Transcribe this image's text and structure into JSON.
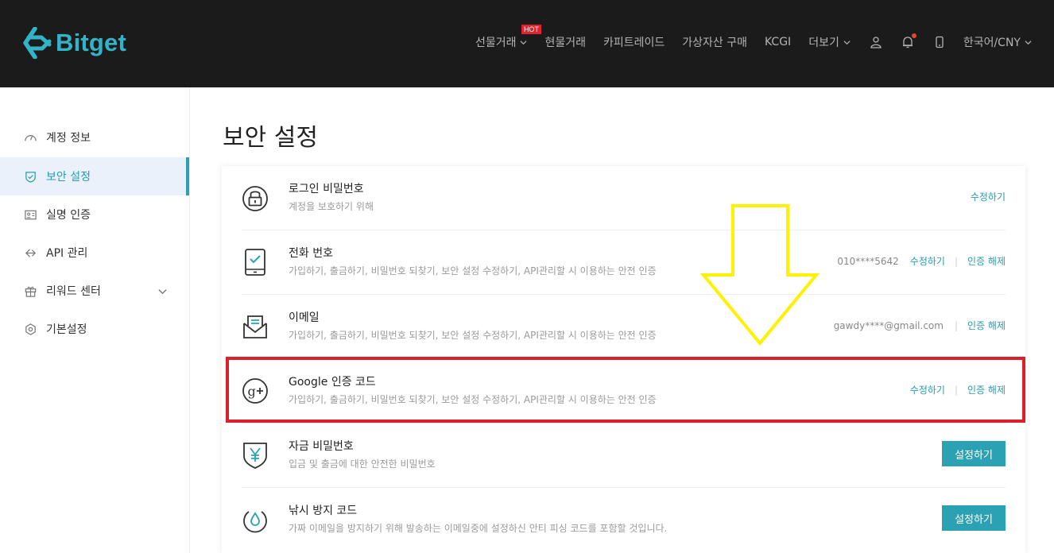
{
  "header": {
    "brand": "Bitget",
    "brand_color": "#32b3c8",
    "nav": {
      "futures": "선물거래",
      "hot_badge": "HOT",
      "spot": "현물거래",
      "copy_trade": "카피트레이드",
      "buy_crypto": "가상자산 구매",
      "kcgi": "KCGI",
      "more": "더보기",
      "language": "한국어/CNY"
    },
    "icons": [
      "user-icon",
      "bell-icon",
      "phone-icon"
    ]
  },
  "sidebar": {
    "items": [
      {
        "label": "계정 정보",
        "icon": "speedometer-icon"
      },
      {
        "label": "보안 설정",
        "icon": "shield-check-icon",
        "active": true
      },
      {
        "label": "실명 인증",
        "icon": "id-card-icon"
      },
      {
        "label": "API 관리",
        "icon": "api-icon"
      },
      {
        "label": "리워드 센터",
        "icon": "gift-icon"
      },
      {
        "label": "기본설정",
        "icon": "settings-icon"
      }
    ]
  },
  "main": {
    "title": "보안 설정",
    "rows": [
      {
        "title": "로그인 비밀번호",
        "desc": "계정을 보호하기 위해",
        "icon": "lock-icon",
        "edit": "수정하기"
      },
      {
        "title": "전화 번호",
        "desc": "가입하기, 출금하기, 비밀번호 되찾기, 보안 설정 수정하기, API관리할 시 이용하는 안전 인증",
        "icon": "phone-check-icon",
        "masked": "010****5642",
        "edit": "수정하기",
        "unbind": "인증 해제"
      },
      {
        "title": "이메일",
        "desc": "가입하기, 출금하기, 비밀번호 되찾기, 보안 설정 수정하기, API관리할 시 이용하는 안전 인증",
        "icon": "mail-icon",
        "masked": "gawdy****@gmail.com",
        "unbind": "인증 해제"
      },
      {
        "title": "Google 인증 코드",
        "desc": "가입하기, 출금하기, 비밀번호 되찾기, 보안 설정 수정하기, API관리할 시 이용하는 안전 인증",
        "icon": "google-plus-icon",
        "edit": "수정하기",
        "unbind": "인증 해제"
      },
      {
        "title": "자금 비밀번호",
        "desc": "입금 및 출금에 대한 안전한 비밀번호",
        "icon": "yen-shield-icon",
        "button": "설정하기"
      },
      {
        "title": "낚시 방지 코드",
        "desc": "가짜 이메일을 방지하기 위해 발송하는 이메일중에 설정하신 안티 피싱 코드를 포함할 것입니다.",
        "icon": "drop-icon",
        "button": "설정하기"
      }
    ]
  },
  "colors": {
    "accent": "#2aa2b4",
    "highlight_box": "#dd1f2b",
    "arrow": "#fff200",
    "header_bg": "#1c1b1b"
  }
}
